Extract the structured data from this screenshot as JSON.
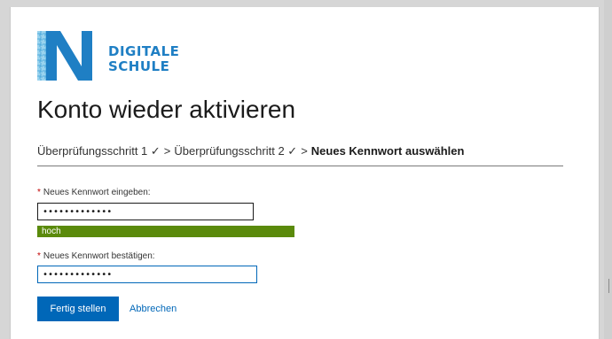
{
  "brand": {
    "line1": "DIGITALE",
    "line2": "SCHULE",
    "color": "#1f7fc4"
  },
  "page": {
    "title": "Konto wieder aktivieren"
  },
  "breadcrumb": {
    "step1": "Überprüfungsschritt 1 ✓",
    "step2": "Überprüfungsschritt 2 ✓",
    "current": "Neues Kennwort auswählen",
    "separator": ">"
  },
  "form": {
    "required_marker": "*",
    "new_password_label": "Neues Kennwort eingeben:",
    "new_password_value": "•••••••••••••",
    "strength_label": "hoch",
    "confirm_password_label": "Neues Kennwort bestätigen:",
    "confirm_password_value": "•••••••••••••"
  },
  "actions": {
    "submit_label": "Fertig stellen",
    "cancel_label": "Abbrechen"
  },
  "colors": {
    "accent": "#0067b8",
    "strength_high": "#5a8a0b",
    "required": "#c10000"
  }
}
